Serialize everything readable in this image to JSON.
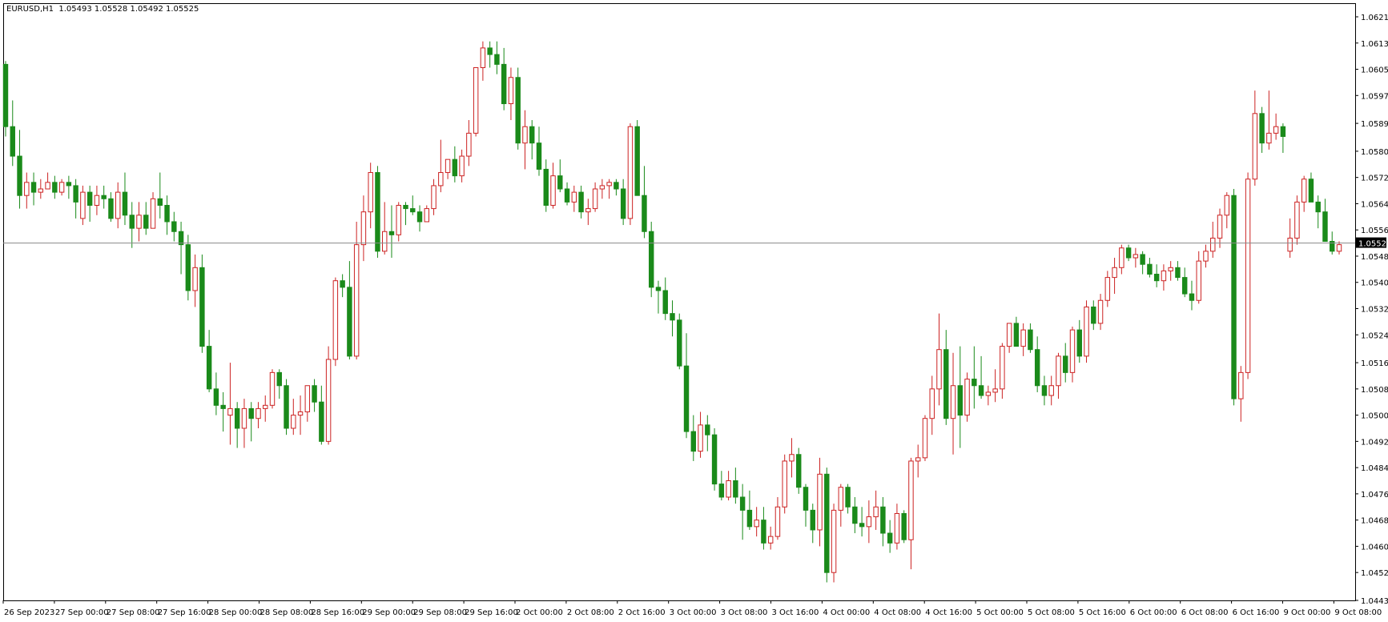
{
  "header": {
    "symbol": "EURUSD,H1",
    "open": "1.05493",
    "high": "1.05528",
    "low": "1.05492",
    "close": "1.05525"
  },
  "price_axis": {
    "tick_labels": [
      "1.06215",
      "1.06135",
      "1.06055",
      "1.05975",
      "1.05890",
      "1.05805",
      "1.05725",
      "1.05645",
      "1.05565",
      "1.05485",
      "1.05405",
      "1.05325",
      "1.05245",
      "1.05160",
      "1.05080",
      "1.05000",
      "1.04920",
      "1.04840",
      "1.04760",
      "1.04680",
      "1.04600",
      "1.04520",
      "1.04435"
    ],
    "current_price_label": "1.05525"
  },
  "time_axis": {
    "tick_labels": [
      "26 Sep 2023",
      "27 Sep 00:00",
      "27 Sep 08:00",
      "27 Sep 16:00",
      "28 Sep 00:00",
      "28 Sep 08:00",
      "28 Sep 16:00",
      "29 Sep 00:00",
      "29 Sep 08:00",
      "29 Sep 16:00",
      "2 Oct 00:00",
      "2 Oct 08:00",
      "2 Oct 16:00",
      "3 Oct 00:00",
      "3 Oct 08:00",
      "3 Oct 16:00",
      "4 Oct 00:00",
      "4 Oct 08:00",
      "4 Oct 16:00",
      "5 Oct 00:00",
      "5 Oct 08:00",
      "5 Oct 16:00",
      "6 Oct 00:00",
      "6 Oct 08:00",
      "6 Oct 16:00",
      "9 Oct 00:00",
      "9 Oct 08:00"
    ]
  },
  "colors": {
    "bull": "#cc2222",
    "bear": "#1a8a1a",
    "price_line": "#8a8a8a",
    "grid_border": "#000000"
  },
  "chart_data": {
    "type": "candlestick",
    "symbol": "EURUSD",
    "timeframe": "H1",
    "ylim": [
      1.04435,
      1.06215
    ],
    "current_price": 1.05525,
    "candles": [
      [
        1.0607,
        1.0608,
        1.0585,
        1.0588
      ],
      [
        1.0588,
        1.0596,
        1.0576,
        1.0579
      ],
      [
        1.0579,
        1.0587,
        1.0563,
        1.0567
      ],
      [
        1.0567,
        1.0574,
        1.0563,
        1.0571
      ],
      [
        1.0571,
        1.0574,
        1.0564,
        1.0568
      ],
      [
        1.0568,
        1.0572,
        1.0566,
        1.0569
      ],
      [
        1.0569,
        1.0574,
        1.0569,
        1.0571
      ],
      [
        1.0571,
        1.0573,
        1.0566,
        1.0568
      ],
      [
        1.0568,
        1.0572,
        1.0567,
        1.0571
      ],
      [
        1.0571,
        1.0573,
        1.0566,
        1.057
      ],
      [
        1.057,
        1.0572,
        1.056,
        1.0565
      ],
      [
        1.056,
        1.057,
        1.0558,
        1.0568
      ],
      [
        1.0568,
        1.057,
        1.0559,
        1.0564
      ],
      [
        1.0564,
        1.057,
        1.0561,
        1.0567
      ],
      [
        1.0567,
        1.057,
        1.0563,
        1.0566
      ],
      [
        1.0566,
        1.0568,
        1.0559,
        1.056
      ],
      [
        1.056,
        1.0571,
        1.0557,
        1.0568
      ],
      [
        1.0568,
        1.0574,
        1.0558,
        1.0561
      ],
      [
        1.0561,
        1.0565,
        1.0551,
        1.0557
      ],
      [
        1.0557,
        1.0565,
        1.0553,
        1.0561
      ],
      [
        1.0561,
        1.0565,
        1.0555,
        1.0557
      ],
      [
        1.0557,
        1.0568,
        1.0557,
        1.0566
      ],
      [
        1.0566,
        1.0574,
        1.056,
        1.0564
      ],
      [
        1.0564,
        1.0567,
        1.0555,
        1.0559
      ],
      [
        1.0559,
        1.0562,
        1.0553,
        1.0556
      ],
      [
        1.0556,
        1.0559,
        1.0543,
        1.0552
      ],
      [
        1.0552,
        1.0555,
        1.0535,
        1.0538
      ],
      [
        1.0538,
        1.0549,
        1.0533,
        1.0545
      ],
      [
        1.0545,
        1.0549,
        1.0519,
        1.0521
      ],
      [
        1.0521,
        1.0526,
        1.0507,
        1.0508
      ],
      [
        1.0508,
        1.0513,
        1.05,
        1.0503
      ],
      [
        1.0503,
        1.0507,
        1.0495,
        1.0502
      ],
      [
        1.05,
        1.0516,
        1.0491,
        1.0502
      ],
      [
        1.0502,
        1.0504,
        1.049,
        1.0496
      ],
      [
        1.0496,
        1.0505,
        1.049,
        1.0502
      ],
      [
        1.0502,
        1.0504,
        1.0492,
        1.0499
      ],
      [
        1.0499,
        1.0504,
        1.0496,
        1.0502
      ],
      [
        1.0502,
        1.0506,
        1.0498,
        1.0503
      ],
      [
        1.0503,
        1.0514,
        1.0502,
        1.0513
      ],
      [
        1.0513,
        1.0514,
        1.0505,
        1.0509
      ],
      [
        1.0509,
        1.0511,
        1.0494,
        1.0496
      ],
      [
        1.0496,
        1.0505,
        1.0494,
        1.05
      ],
      [
        1.05,
        1.0506,
        1.0494,
        1.0501
      ],
      [
        1.0501,
        1.0509,
        1.0498,
        1.0509
      ],
      [
        1.0509,
        1.0511,
        1.0501,
        1.0504
      ],
      [
        1.0504,
        1.0509,
        1.0491,
        1.0492
      ],
      [
        1.0492,
        1.0521,
        1.0491,
        1.0517
      ],
      [
        1.0517,
        1.0542,
        1.0515,
        1.0541
      ],
      [
        1.0541,
        1.0543,
        1.0536,
        1.0539
      ],
      [
        1.0539,
        1.0547,
        1.0517,
        1.0518
      ],
      [
        1.0518,
        1.0559,
        1.0517,
        1.0552
      ],
      [
        1.0552,
        1.0567,
        1.0547,
        1.0562
      ],
      [
        1.0562,
        1.0577,
        1.0557,
        1.0574
      ],
      [
        1.0574,
        1.0576,
        1.0548,
        1.055
      ],
      [
        1.055,
        1.0565,
        1.0549,
        1.0556
      ],
      [
        1.0556,
        1.0564,
        1.0548,
        1.0555
      ],
      [
        1.0555,
        1.0565,
        1.0553,
        1.0564
      ],
      [
        1.0564,
        1.0565,
        1.0558,
        1.0563
      ],
      [
        1.0563,
        1.0567,
        1.0561,
        1.0562
      ],
      [
        1.0562,
        1.0564,
        1.0556,
        1.0559
      ],
      [
        1.0559,
        1.0564,
        1.0559,
        1.0563
      ],
      [
        1.0563,
        1.0572,
        1.0561,
        1.057
      ],
      [
        1.057,
        1.0584,
        1.0568,
        1.0574
      ],
      [
        1.0574,
        1.0577,
        1.0572,
        1.0578
      ],
      [
        1.0578,
        1.0582,
        1.0571,
        1.0573
      ],
      [
        1.0573,
        1.0581,
        1.0571,
        1.0579
      ],
      [
        1.0579,
        1.059,
        1.0576,
        1.0586
      ],
      [
        1.0586,
        1.0603,
        1.0585,
        1.0606
      ],
      [
        1.0606,
        1.0614,
        1.0602,
        1.0612
      ],
      [
        1.0612,
        1.0614,
        1.0606,
        1.061
      ],
      [
        1.061,
        1.0614,
        1.0604,
        1.0607
      ],
      [
        1.0607,
        1.0612,
        1.0593,
        1.0595
      ],
      [
        1.0595,
        1.0606,
        1.059,
        1.0603
      ],
      [
        1.0603,
        1.0606,
        1.0581,
        1.0583
      ],
      [
        1.0583,
        1.0593,
        1.0575,
        1.0588
      ],
      [
        1.0588,
        1.059,
        1.0578,
        1.0583
      ],
      [
        1.0583,
        1.0588,
        1.0573,
        1.0575
      ],
      [
        1.0575,
        1.0578,
        1.0562,
        1.0564
      ],
      [
        1.0564,
        1.0577,
        1.0563,
        1.0573
      ],
      [
        1.0573,
        1.0578,
        1.0568,
        1.0569
      ],
      [
        1.0569,
        1.0571,
        1.0564,
        1.0565
      ],
      [
        1.0565,
        1.057,
        1.0562,
        1.0568
      ],
      [
        1.0568,
        1.057,
        1.056,
        1.0562
      ],
      [
        1.0562,
        1.0566,
        1.0558,
        1.0563
      ],
      [
        1.0563,
        1.0571,
        1.0562,
        1.0569
      ],
      [
        1.0569,
        1.0572,
        1.0566,
        1.057
      ],
      [
        1.057,
        1.0572,
        1.0566,
        1.0571
      ],
      [
        1.0571,
        1.0572,
        1.0567,
        1.0569
      ],
      [
        1.0569,
        1.0572,
        1.0558,
        1.056
      ],
      [
        1.056,
        1.0589,
        1.0558,
        1.0588
      ],
      [
        1.0588,
        1.059,
        1.0577,
        1.0567
      ],
      [
        1.0567,
        1.0576,
        1.0554,
        1.0556
      ],
      [
        1.0556,
        1.0559,
        1.0536,
        1.0539
      ],
      [
        1.0539,
        1.0541,
        1.0531,
        1.0538
      ],
      [
        1.0538,
        1.0542,
        1.0529,
        1.0531
      ],
      [
        1.0531,
        1.0535,
        1.0524,
        1.0529
      ],
      [
        1.0529,
        1.0531,
        1.0514,
        1.0515
      ],
      [
        1.0515,
        1.0525,
        1.0493,
        1.0495
      ],
      [
        1.0495,
        1.05,
        1.0486,
        1.0489
      ],
      [
        1.0489,
        1.0501,
        1.0487,
        1.0497
      ],
      [
        1.0497,
        1.05,
        1.0489,
        1.0494
      ],
      [
        1.0494,
        1.0496,
        1.0477,
        1.0479
      ],
      [
        1.0479,
        1.0483,
        1.0474,
        1.0475
      ],
      [
        1.0475,
        1.0483,
        1.0474,
        1.048
      ],
      [
        1.048,
        1.0484,
        1.0473,
        1.0475
      ],
      [
        1.0475,
        1.0479,
        1.0462,
        1.0471
      ],
      [
        1.0471,
        1.0477,
        1.0465,
        1.0466
      ],
      [
        1.0466,
        1.0472,
        1.0463,
        1.0468
      ],
      [
        1.0468,
        1.0472,
        1.0459,
        1.0461
      ],
      [
        1.0461,
        1.0466,
        1.0459,
        1.0463
      ],
      [
        1.0463,
        1.0475,
        1.0462,
        1.0472
      ],
      [
        1.0472,
        1.0488,
        1.047,
        1.0486
      ],
      [
        1.0486,
        1.0493,
        1.0481,
        1.0488
      ],
      [
        1.0488,
        1.049,
        1.0476,
        1.0478
      ],
      [
        1.0478,
        1.0479,
        1.0466,
        1.0471
      ],
      [
        1.0471,
        1.0473,
        1.0461,
        1.0465
      ],
      [
        1.0465,
        1.0487,
        1.046,
        1.0482
      ],
      [
        1.0482,
        1.0484,
        1.0449,
        1.0452
      ],
      [
        1.0452,
        1.0473,
        1.0449,
        1.0471
      ],
      [
        1.0471,
        1.0479,
        1.0466,
        1.0478
      ],
      [
        1.0478,
        1.0479,
        1.047,
        1.0472
      ],
      [
        1.0472,
        1.0475,
        1.0464,
        1.0467
      ],
      [
        1.0467,
        1.0472,
        1.0463,
        1.0466
      ],
      [
        1.0466,
        1.0474,
        1.0461,
        1.0469
      ],
      [
        1.0469,
        1.0477,
        1.0465,
        1.0472
      ],
      [
        1.0472,
        1.0475,
        1.046,
        1.0464
      ],
      [
        1.0464,
        1.0468,
        1.0458,
        1.0461
      ],
      [
        1.0461,
        1.0473,
        1.0459,
        1.047
      ],
      [
        1.047,
        1.0471,
        1.0461,
        1.0462
      ],
      [
        1.0462,
        1.0487,
        1.0453,
        1.0486
      ],
      [
        1.0486,
        1.0491,
        1.0481,
        1.0487
      ],
      [
        1.0487,
        1.05,
        1.0486,
        1.0499
      ],
      [
        1.0499,
        1.0512,
        1.0494,
        1.0508
      ],
      [
        1.0508,
        1.0531,
        1.0503,
        1.052
      ],
      [
        1.052,
        1.0526,
        1.0497,
        1.0499
      ],
      [
        1.0499,
        1.0519,
        1.0488,
        1.0509
      ],
      [
        1.0509,
        1.0521,
        1.049,
        1.05
      ],
      [
        1.05,
        1.0513,
        1.0498,
        1.0511
      ],
      [
        1.0511,
        1.0521,
        1.0502,
        1.0509
      ],
      [
        1.0509,
        1.0518,
        1.0505,
        1.0506
      ],
      [
        1.0506,
        1.0509,
        1.0503,
        1.0507
      ],
      [
        1.0507,
        1.0514,
        1.0504,
        1.0508
      ],
      [
        1.0508,
        1.0522,
        1.0505,
        1.0521
      ],
      [
        1.0521,
        1.0528,
        1.0519,
        1.0528
      ],
      [
        1.0528,
        1.053,
        1.0521,
        1.0521
      ],
      [
        1.0521,
        1.0528,
        1.0518,
        1.0526
      ],
      [
        1.0526,
        1.0528,
        1.0519,
        1.052
      ],
      [
        1.052,
        1.0524,
        1.0507,
        1.0509
      ],
      [
        1.0509,
        1.0512,
        1.0503,
        1.0506
      ],
      [
        1.0506,
        1.0512,
        1.0503,
        1.0509
      ],
      [
        1.0509,
        1.0519,
        1.0505,
        1.0518
      ],
      [
        1.0518,
        1.0522,
        1.051,
        1.0513
      ],
      [
        1.0513,
        1.0527,
        1.051,
        1.0526
      ],
      [
        1.0526,
        1.0529,
        1.0516,
        1.0518
      ],
      [
        1.0518,
        1.0535,
        1.0516,
        1.0533
      ],
      [
        1.0533,
        1.0535,
        1.0526,
        1.0528
      ],
      [
        1.0528,
        1.0537,
        1.0526,
        1.0535
      ],
      [
        1.0535,
        1.0544,
        1.0533,
        1.0542
      ],
      [
        1.0542,
        1.0548,
        1.0537,
        1.0545
      ],
      [
        1.0545,
        1.0552,
        1.0543,
        1.0551
      ],
      [
        1.0551,
        1.0552,
        1.0547,
        1.0548
      ],
      [
        1.0548,
        1.0551,
        1.0545,
        1.0549
      ],
      [
        1.0549,
        1.055,
        1.0543,
        1.0546
      ],
      [
        1.0546,
        1.0548,
        1.0542,
        1.0543
      ],
      [
        1.0543,
        1.0546,
        1.0539,
        1.0541
      ],
      [
        1.0541,
        1.0546,
        1.0538,
        1.0544
      ],
      [
        1.0544,
        1.0547,
        1.0541,
        1.0545
      ],
      [
        1.0545,
        1.0547,
        1.0541,
        1.0542
      ],
      [
        1.0542,
        1.0545,
        1.0536,
        1.0537
      ],
      [
        1.0537,
        1.0541,
        1.0532,
        1.0535
      ],
      [
        1.0535,
        1.055,
        1.0534,
        1.0547
      ],
      [
        1.0547,
        1.0552,
        1.0545,
        1.055
      ],
      [
        1.055,
        1.0559,
        1.0548,
        1.0554
      ],
      [
        1.0554,
        1.0563,
        1.0551,
        1.0561
      ],
      [
        1.0561,
        1.0568,
        1.0557,
        1.0567
      ],
      [
        1.0567,
        1.0569,
        1.0503,
        1.0505
      ],
      [
        1.0505,
        1.0515,
        1.0498,
        1.0513
      ],
      [
        1.0513,
        1.0574,
        1.0511,
        1.0572
      ],
      [
        1.0572,
        1.0599,
        1.057,
        1.0592
      ],
      [
        1.0592,
        1.0594,
        1.058,
        1.0583
      ],
      [
        1.0583,
        1.0599,
        1.0581,
        1.0586
      ],
      [
        1.0586,
        1.0592,
        1.0584,
        1.0588
      ],
      [
        1.0588,
        1.0589,
        1.058,
        1.0585
      ],
      [
        1.055,
        1.056,
        1.0548,
        1.0554
      ],
      [
        1.0554,
        1.0567,
        1.0552,
        1.0565
      ],
      [
        1.0565,
        1.0573,
        1.0562,
        1.0572
      ],
      [
        1.0572,
        1.0574,
        1.0565,
        1.0565
      ],
      [
        1.0565,
        1.0567,
        1.0557,
        1.0562
      ],
      [
        1.0562,
        1.0566,
        1.0556,
        1.0553
      ],
      [
        1.0553,
        1.0556,
        1.0549,
        1.055
      ],
      [
        1.055,
        1.0553,
        1.0549,
        1.0552
      ]
    ]
  }
}
